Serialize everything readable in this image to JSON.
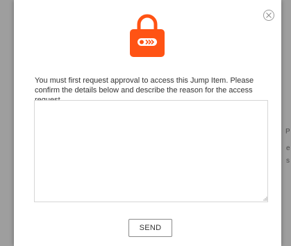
{
  "dialog": {
    "message": "You must first request approval to access this Jump Item. Please confirm the details below and describe the reason for the access request.",
    "reason_field": {
      "value": "",
      "placeholder": ""
    },
    "send_label": "SEND"
  },
  "background": {
    "edge_fragments": [
      "P",
      "e",
      "s"
    ]
  },
  "colors": {
    "accent": "#ff5314",
    "overlay": "#9e9e9e"
  },
  "icons": {
    "lock": "padlock-icon",
    "close": "close-circle-icon"
  }
}
